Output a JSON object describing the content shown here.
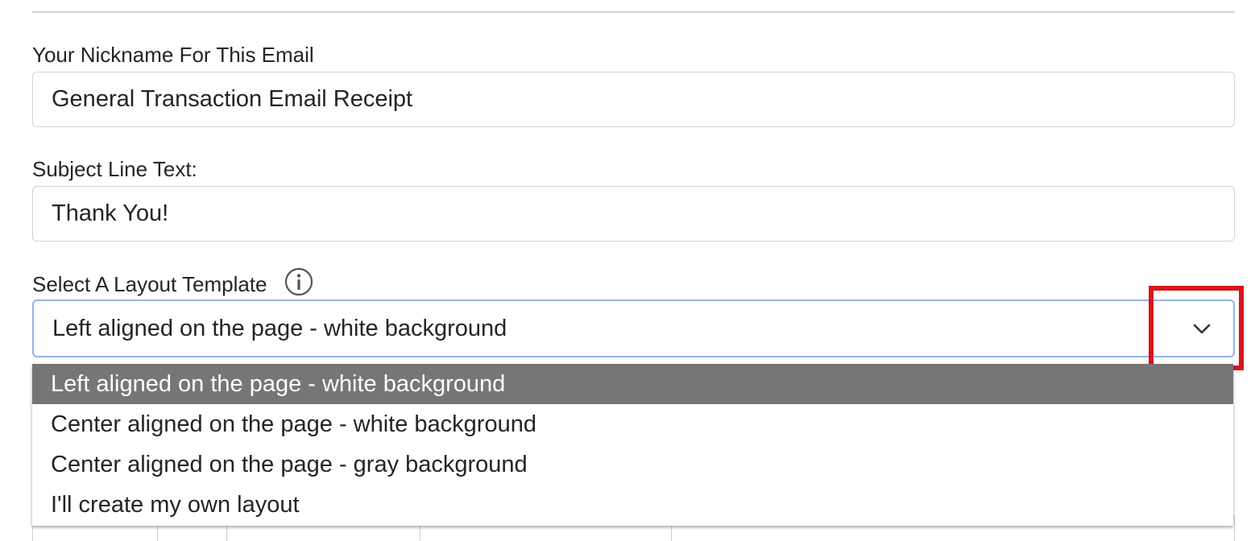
{
  "nickname": {
    "label": "Your Nickname For This Email",
    "value": "General Transaction Email Receipt"
  },
  "subject": {
    "label": "Subject Line Text:",
    "value": "Thank You!"
  },
  "layout_template": {
    "label": "Select A Layout Template",
    "info_icon": "info-circle-icon",
    "selected_value": "Left aligned on the page - white background",
    "chevron_icon": "chevron-down-icon",
    "options": [
      {
        "label": "Left aligned on the page - white background",
        "selected": true
      },
      {
        "label": "Center aligned on the page - white background",
        "selected": false
      },
      {
        "label": "Center aligned on the page - gray background",
        "selected": false
      },
      {
        "label": "I'll create my own layout",
        "selected": false
      }
    ]
  },
  "colors": {
    "selected_option_bg": "#767676",
    "select_focus_border": "#8fb4ea",
    "highlight_annotation": "#d9141c"
  }
}
